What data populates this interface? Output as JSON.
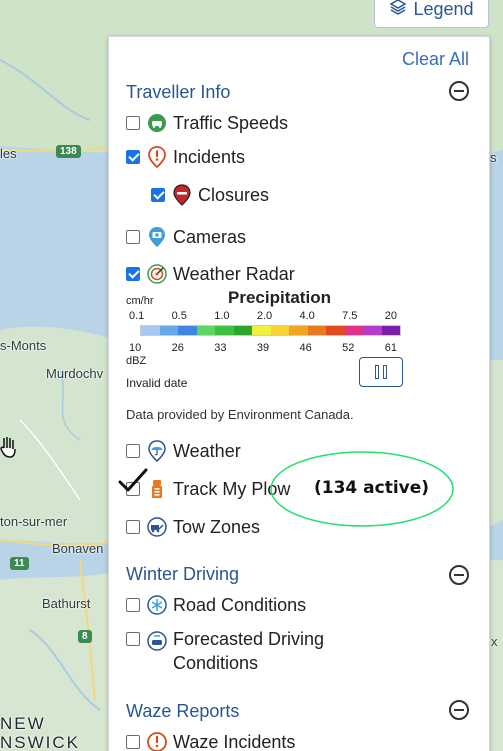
{
  "map": {
    "labels": {
      "les": "les",
      "monts": "s-Monts",
      "murdoch": "Murdochv",
      "sur_mer": "ton-sur-mer",
      "bonaven": "Bonaven",
      "bathurst": "Bathurst",
      "new": "NEW",
      "nswick": "NSWICK",
      "fragment_s": "s",
      "fragment_x": "x"
    },
    "shields": {
      "r138": "138",
      "r11": "11",
      "r8": "8"
    }
  },
  "legend_button": {
    "label": "Legend",
    "icon": "layers-icon"
  },
  "panel": {
    "clear_all": "Clear All",
    "sections": {
      "traveller": {
        "title": "Traveller Info",
        "items": {
          "traffic": {
            "label": "Traffic Speeds",
            "checked": false,
            "icon": "car-icon"
          },
          "incidents": {
            "label": "Incidents",
            "checked": true,
            "icon": "alert-pin-icon"
          },
          "closures": {
            "label": "Closures",
            "checked": true,
            "icon": "closure-pin-icon"
          },
          "cameras": {
            "label": "Cameras",
            "checked": false,
            "icon": "camera-pin-icon"
          },
          "radar": {
            "label": "Weather Radar",
            "checked": true,
            "icon": "radar-icon"
          }
        },
        "precipitation": {
          "title": "Precipitation",
          "unit_top": "cm/hr",
          "unit_bottom": "dBZ",
          "top_values": [
            "0.1",
            "0.5",
            "1.0",
            "2.0",
            "4.0",
            "7.5",
            "20"
          ],
          "bottom_values": [
            "10",
            "26",
            "33",
            "39",
            "46",
            "52",
            "61"
          ],
          "colors": [
            "#a6c8f2",
            "#6aa6ec",
            "#3f86e2",
            "#60d460",
            "#3fbf3f",
            "#2ca52c",
            "#f0f03c",
            "#f7d237",
            "#f0a524",
            "#e87b22",
            "#e04a1e",
            "#e0338a",
            "#b43ccc",
            "#7a1fa8"
          ],
          "timestamp": "Invalid date",
          "pause_icon": "pause-icon"
        },
        "provided_by": "Data provided by Environment Canada.",
        "more_items": {
          "weather": {
            "label": "Weather",
            "checked": false,
            "icon": "umbrella-pin-icon"
          },
          "plow": {
            "label": "Track My Plow",
            "checked": false,
            "icon": "plow-icon"
          },
          "tow": {
            "label": "Tow Zones",
            "checked": false,
            "icon": "tow-truck-icon"
          }
        }
      },
      "winter": {
        "title": "Winter Driving",
        "items": {
          "road": {
            "label": "Road Conditions",
            "checked": false,
            "icon": "snowflake-icon"
          },
          "forecast_line1": "Forecasted Driving",
          "forecast_line2": "Conditions",
          "forecast_checked": false,
          "forecast_icon": "forecast-car-icon"
        }
      },
      "waze": {
        "title": "Waze Reports",
        "items": {
          "incidents": {
            "label": "Waze Incidents",
            "checked": false,
            "icon": "waze-alert-icon"
          }
        }
      }
    }
  },
  "annotation": {
    "text": "(134 active)",
    "colors": {
      "ellipse": "#22e06a",
      "check": "#111111"
    }
  },
  "colors": {
    "accent": "#2a5593",
    "link": "#3a6fb5",
    "checkbox": "#1a73e8"
  }
}
